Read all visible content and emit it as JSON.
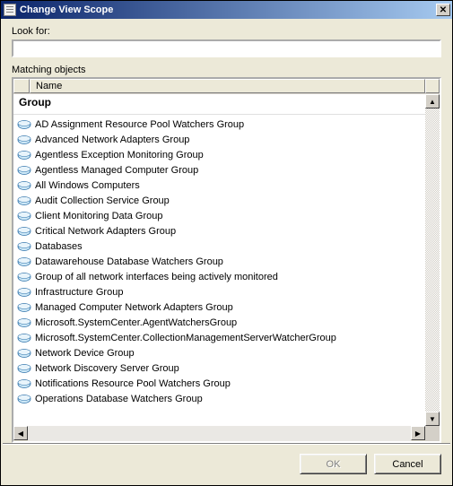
{
  "window": {
    "title": "Change View Scope"
  },
  "labels": {
    "look_for": "Look for:",
    "matching_objects": "Matching objects"
  },
  "search": {
    "value": "",
    "placeholder": ""
  },
  "columns": {
    "name": "Name"
  },
  "group_header": "Group",
  "items": [
    {
      "label": "AD Assignment Resource Pool Watchers Group"
    },
    {
      "label": "Advanced Network Adapters Group"
    },
    {
      "label": "Agentless Exception Monitoring Group"
    },
    {
      "label": "Agentless Managed Computer Group"
    },
    {
      "label": "All Windows Computers"
    },
    {
      "label": "Audit Collection Service Group"
    },
    {
      "label": "Client Monitoring Data Group"
    },
    {
      "label": "Critical Network Adapters Group"
    },
    {
      "label": "Databases"
    },
    {
      "label": "Datawarehouse Database Watchers Group"
    },
    {
      "label": "Group of all network interfaces being actively monitored"
    },
    {
      "label": "Infrastructure Group"
    },
    {
      "label": "Managed Computer Network Adapters Group"
    },
    {
      "label": "Microsoft.SystemCenter.AgentWatchersGroup"
    },
    {
      "label": "Microsoft.SystemCenter.CollectionManagementServerWatcherGroup"
    },
    {
      "label": "Network Device Group"
    },
    {
      "label": "Network Discovery Server Group"
    },
    {
      "label": "Notifications Resource Pool Watchers Group"
    },
    {
      "label": "Operations Database Watchers Group"
    }
  ],
  "buttons": {
    "ok": "OK",
    "cancel": "Cancel"
  }
}
